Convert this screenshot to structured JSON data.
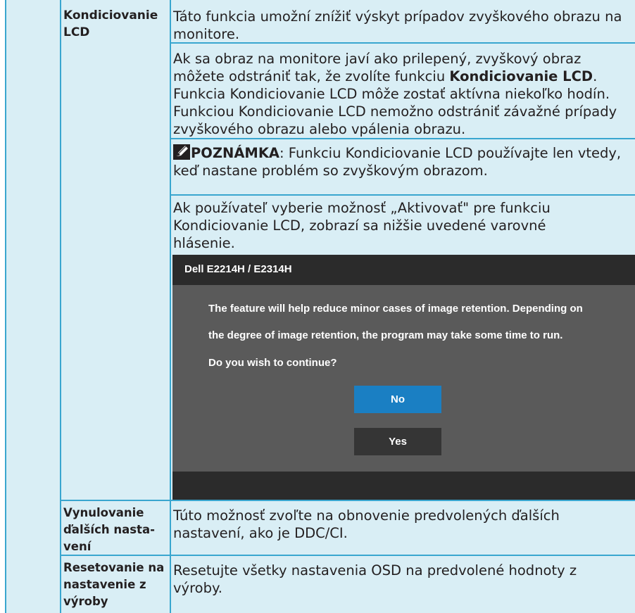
{
  "rows": [
    {
      "label": "Kondiciovanie LCD",
      "paragraphs": {
        "p1": "Táto funkcia umožní znížiť výskyt prípadov zvyškového obrazu na monitore.",
        "p2_before": "Ak sa obraz na monitore javí ako prilepený, zvyškový obraz môžete odstrániť tak, že zvolíte funkciu ",
        "p2_bold": "Kondiciovanie LCD",
        "p2_after": ". Funkcia Kondiciovanie LCD môže zostať aktívna niekoľko hodín.  Funkciou Kondiciovanie LCD nemožno odstrániť závažné prípady zvyškového obrazu alebo vpálenia obrazu.",
        "note_label": "POZNÁMKA",
        "note_text": ": Funkciu Kondiciovanie LCD používajte len vtedy, keď nastane problém so zvyškovým obrazom.",
        "p4": "Ak používateľ vyberie možnosť „Aktivovať\" pre funkciu Kondiciovanie LCD, zobrazí sa nižšie uvedené varovné hlásenie."
      }
    },
    {
      "label": "Vynulovanie ďalších nasta-vení",
      "text": "Túto možnosť zvoľte na obnovenie predvolených ďalších nastavení, ako je DDC/CI."
    },
    {
      "label": "Resetovanie na nastavenie z výroby",
      "text": "Resetujte všetky nastavenia OSD na predvolené hodnoty z výroby."
    }
  ],
  "osd": {
    "title": "Dell E2214H / E2314H",
    "line1": "The feature will help reduce minor cases of image retention. Depending on",
    "line2": "the degree of image retention, the program may take some time to run.",
    "line3": "Do you wish to continue?",
    "no_label": "No",
    "yes_label": "Yes"
  },
  "colors": {
    "table_bg": "#d9eef5",
    "table_border": "#39a6cf",
    "osd_bg": "#5a5a5a",
    "osd_bar": "#2b2b2b",
    "no_button": "#1a7fc3",
    "yes_button": "#353535"
  },
  "icons": [
    "note-icon"
  ]
}
